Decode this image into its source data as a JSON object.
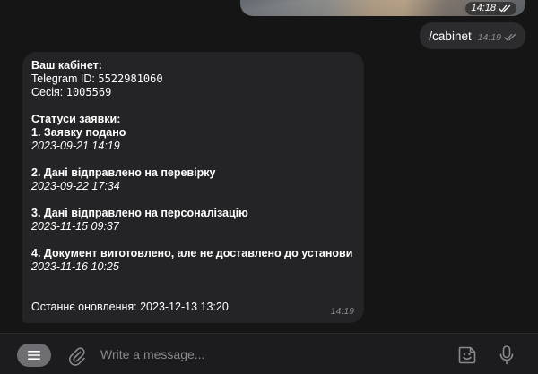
{
  "top_photo": {
    "time": "14:18"
  },
  "outgoing": {
    "text": "/cabinet",
    "time": "14:19"
  },
  "incoming": {
    "header": "Ваш кабінет:",
    "telegram_label": "Telegram ID: ",
    "telegram_id": "5522981060",
    "session_label": "Сесія: ",
    "session_id": "1005569",
    "statuses_title": "Статуси заявки:",
    "statuses": [
      {
        "title": "1. Заявку подано",
        "date": "2023-09-21 14:19"
      },
      {
        "title": "2. Дані відправлено на перевірку",
        "date": "2023-09-22 17:34"
      },
      {
        "title": "3. Дані відправлено на персоналізацію",
        "date": "2023-11-15 09:37"
      },
      {
        "title": "4. Документ виготовлено, але не доставлено до установи",
        "date": "2023-11-16 10:25"
      }
    ],
    "last_update": "Останнє оновлення: 2023-12-13 13:20",
    "time": "14:19"
  },
  "composer": {
    "placeholder": "Write a message..."
  },
  "icons": {
    "menu": "menu-icon",
    "attach": "paperclip-icon",
    "sticker": "sticker-icon",
    "mic": "microphone-icon",
    "read": "double-check-icon"
  },
  "colors": {
    "background": "#151515",
    "incoming_bubble": "#242426",
    "outgoing_bubble": "#2c2c2e",
    "composer": "#1c1c1e",
    "meta_text": "#8a8a8e"
  }
}
